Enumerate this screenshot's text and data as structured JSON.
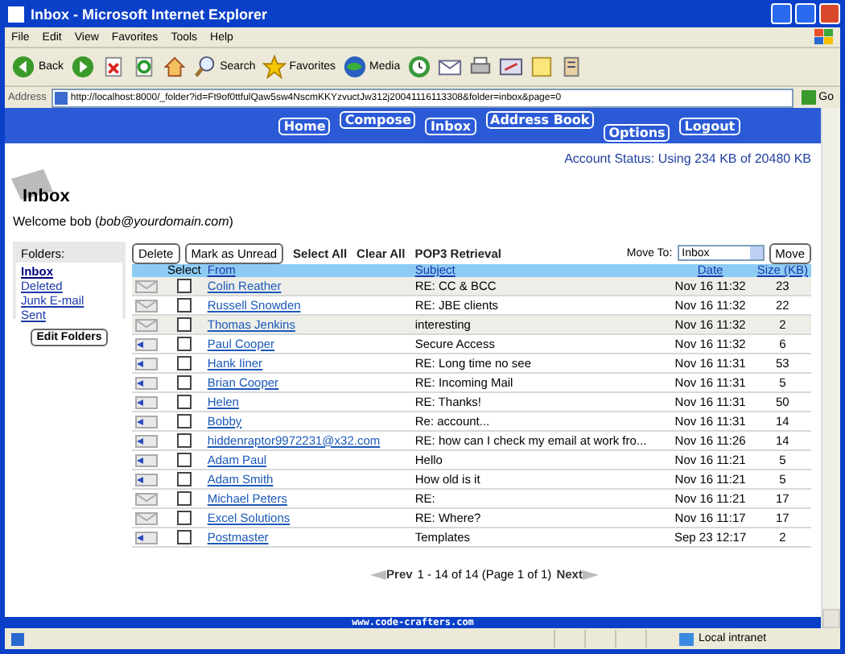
{
  "window": {
    "title": "Inbox - Microsoft Internet Explorer"
  },
  "menu": [
    "File",
    "Edit",
    "View",
    "Favorites",
    "Tools",
    "Help"
  ],
  "toolbar": [
    {
      "kind": "back",
      "label": "Back"
    },
    {
      "kind": "forward"
    },
    {
      "kind": "stop"
    },
    {
      "kind": "refresh"
    },
    {
      "kind": "home"
    },
    {
      "kind": "search",
      "label": "Search"
    },
    {
      "kind": "favorites",
      "label": "Favorites"
    },
    {
      "kind": "media",
      "label": "Media"
    },
    {
      "kind": "history"
    },
    {
      "kind": "mail"
    },
    {
      "kind": "print"
    },
    {
      "kind": "edit"
    },
    {
      "kind": "note"
    },
    {
      "kind": "tools"
    }
  ],
  "address": {
    "label": "Address",
    "url": "http://localhost:8000/_folder?id=Ft9of0ttfulQaw5sw4NscmKKYzvuctJw312j20041116113308&folder=inbox&page=0",
    "go": "Go"
  },
  "nav": [
    "Home",
    "Compose",
    "Inbox",
    "Address Book",
    "Options",
    "Logout"
  ],
  "account_status": "Account Status: Using 234 KB of 20480 KB",
  "heading": "Inbox",
  "welcome": "Welcome bob (*bob@yourdomain.com*)",
  "folders": {
    "title": "Folders:",
    "items": [
      {
        "label": "Inbox",
        "selected": true
      },
      {
        "label": "Deleted",
        "selected": false
      },
      {
        "label": "Junk E-mail",
        "selected": false
      },
      {
        "label": "Sent",
        "selected": false
      }
    ],
    "button": "Edit Folders"
  },
  "actions": {
    "buttons": [
      "Delete",
      "Mark as Unread"
    ],
    "links": [
      "Select All",
      "Clear All",
      "POP3 Retrieval"
    ],
    "move_label": "Move To:",
    "move_value": "Inbox",
    "move_button": "Move"
  },
  "table": {
    "columns": [
      "Select",
      "From",
      "Subject",
      "Date",
      "Size (KB)"
    ],
    "rows": [
      {
        "replied": false,
        "highlighted": true,
        "checked": false,
        "from": "Colin Reather",
        "subject": "RE: CC & BCC",
        "date": "Nov 16 11:32",
        "size": "23"
      },
      {
        "replied": false,
        "highlighted": false,
        "checked": false,
        "from": "Russell Snowden",
        "subject": "RE: JBE clients",
        "date": "Nov 16 11:32",
        "size": "22"
      },
      {
        "replied": false,
        "highlighted": true,
        "checked": false,
        "from": "Thomas Jenkins",
        "subject": "interesting",
        "date": "Nov 16 11:32",
        "size": "2"
      },
      {
        "replied": true,
        "highlighted": false,
        "checked": false,
        "from": "Paul Cooper",
        "subject": "Secure Access",
        "date": "Nov 16 11:32",
        "size": "6"
      },
      {
        "replied": true,
        "highlighted": false,
        "checked": false,
        "from": "Hank Iiner",
        "subject": "RE: Long time no see",
        "date": "Nov 16 11:31",
        "size": "53"
      },
      {
        "replied": true,
        "highlighted": false,
        "checked": false,
        "from": "Brian Cooper",
        "subject": "RE: Incoming Mail",
        "date": "Nov 16 11:31",
        "size": "5"
      },
      {
        "replied": true,
        "highlighted": false,
        "checked": false,
        "from": "Helen",
        "subject": "RE: Thanks!",
        "date": "Nov 16 11:31",
        "size": "50"
      },
      {
        "replied": true,
        "highlighted": false,
        "checked": false,
        "from": "Bobby",
        "subject": "Re: account...",
        "date": "Nov 16 11:31",
        "size": "14"
      },
      {
        "replied": true,
        "highlighted": false,
        "checked": false,
        "from": "hiddenraptor9972231@x32.com",
        "subject": "RE: how can I check my email at work fro...",
        "date": "Nov 16 11:26",
        "size": "14"
      },
      {
        "replied": true,
        "highlighted": false,
        "checked": false,
        "from": "Adam Paul",
        "subject": "Hello",
        "date": "Nov 16 11:21",
        "size": "5"
      },
      {
        "replied": true,
        "highlighted": false,
        "checked": false,
        "from": "Adam Smith",
        "subject": "How old is it",
        "date": "Nov 16 11:21",
        "size": "5"
      },
      {
        "replied": false,
        "highlighted": false,
        "checked": false,
        "from": "Michael Peters",
        "subject": "RE:",
        "date": "Nov 16 11:21",
        "size": "17"
      },
      {
        "replied": false,
        "highlighted": false,
        "checked": false,
        "from": "Excel Solutions",
        "subject": "RE: Where?",
        "date": "Nov 16 11:17",
        "size": "17"
      },
      {
        "replied": true,
        "highlighted": false,
        "checked": false,
        "from": "Postmaster",
        "subject": "Templates",
        "date": "Sep 23 12:17",
        "size": "2"
      }
    ]
  },
  "pagination": {
    "prev": "Prev",
    "info": "1 - 14 of 14 (Page 1 of 1)",
    "next": "Next"
  },
  "footer": "www.code-crafters.com",
  "status_bar": {
    "zone": "Local intranet"
  }
}
